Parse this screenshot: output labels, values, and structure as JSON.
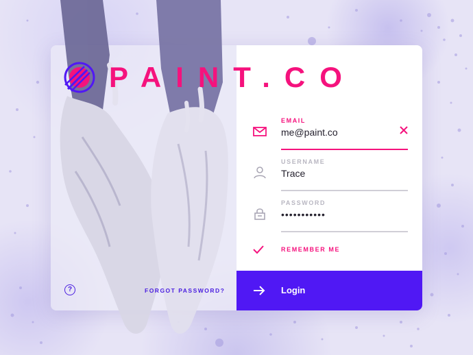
{
  "brand": {
    "name": "PAINT.CO",
    "accent": "#f5127d",
    "primary": "#5018f4"
  },
  "form": {
    "email": {
      "label": "EMAIL",
      "value": "me@paint.co",
      "icon": "envelope-icon",
      "clear_icon": "close-icon"
    },
    "username": {
      "label": "USERNAME",
      "value": "Trace",
      "icon": "user-icon"
    },
    "password": {
      "label": "PASSWORD",
      "value": "•••••••••••",
      "icon": "lock-icon"
    },
    "remember": {
      "label": "REMEMBER ME",
      "checked": true,
      "icon": "checkmark-icon"
    },
    "login": {
      "label": "Login",
      "icon": "arrow-right-icon"
    }
  },
  "footer": {
    "help_symbol": "?",
    "forgot_label": "FORGOT PASSWORD?"
  }
}
